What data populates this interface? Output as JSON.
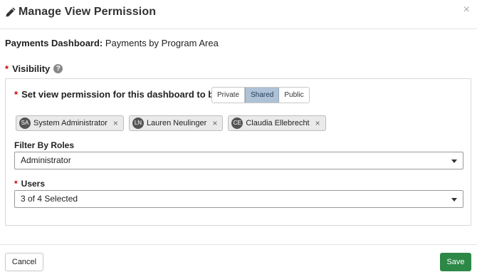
{
  "header": {
    "title": "Manage View Permission",
    "close_glyph": "×",
    "icon": "pencil-icon"
  },
  "dashboard": {
    "label": "Payments Dashboard:",
    "value": "Payments by Program Area"
  },
  "visibility": {
    "label": "Visibility",
    "required_mark": "*",
    "help_glyph": "?"
  },
  "permission": {
    "label": "Set view permission for this dashboard to be:",
    "required_mark": "*",
    "options": [
      "Private",
      "Shared",
      "Public"
    ],
    "selected": "Shared"
  },
  "selected_users": [
    {
      "initials": "SA",
      "name": "System Administrator",
      "remove": "×"
    },
    {
      "initials": "LN",
      "name": "Lauren Neulinger",
      "remove": "×"
    },
    {
      "initials": "CE",
      "name": "Claudia Ellebrecht",
      "remove": "×"
    }
  ],
  "filter_roles": {
    "label": "Filter By Roles",
    "value": "Administrator"
  },
  "users": {
    "label": "Users",
    "required_mark": "*",
    "value": "3 of 4 Selected"
  },
  "footer": {
    "cancel_label": "Cancel",
    "save_label": "Save"
  },
  "colors": {
    "save_button": "#2d8847",
    "selected_toggle": "#aec1d5",
    "required": "#cc0000"
  }
}
